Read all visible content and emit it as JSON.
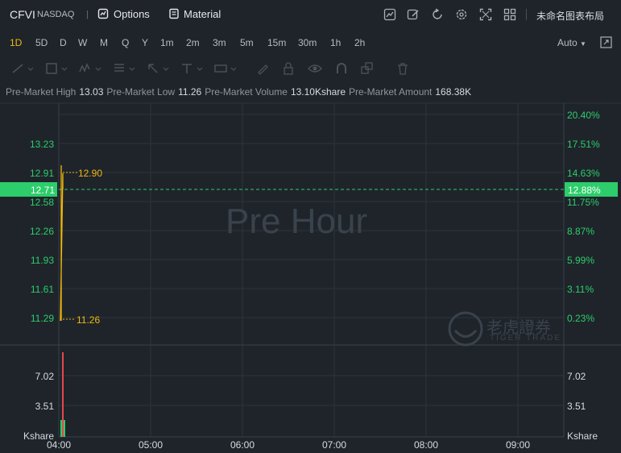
{
  "header": {
    "symbol": "CFVI",
    "exchange": "NASDAQ",
    "separator": "|",
    "options_label": "Options",
    "material_label": "Material",
    "layout_name": "未命名图表布局"
  },
  "periods": [
    "1D",
    "5D",
    "D",
    "W",
    "M",
    "Q",
    "Y",
    "1m",
    "2m",
    "3m",
    "5m",
    "15m",
    "30m",
    "1h",
    "2h"
  ],
  "active_period": "1D",
  "scale_mode": "Auto",
  "premarket": {
    "high_label": "Pre-Market High",
    "high": "13.03",
    "low_label": "Pre-Market Low",
    "low": "11.26",
    "volume_label": "Pre-Market Volume",
    "volume": "13.10Kshare",
    "amount_label": "Pre-Market Amount",
    "amount": "168.38K"
  },
  "price_axis": {
    "left_ticks": [
      "13.23",
      "12.91",
      "12.58",
      "12.26",
      "11.93",
      "11.61",
      "11.29"
    ],
    "right_ticks": [
      "20.40%",
      "17.51%",
      "14.63%",
      "11.75%",
      "8.87%",
      "5.99%",
      "3.11%",
      "0.23%"
    ],
    "current_price": "12.71",
    "current_pct": "12.88%",
    "high_marker": "12.90",
    "low_marker": "11.26"
  },
  "volume_axis": {
    "ticks": [
      "7.02",
      "3.51"
    ],
    "unit": "Kshare"
  },
  "time_axis": [
    "04:00",
    "05:00",
    "06:00",
    "07:00",
    "08:00",
    "09:00"
  ],
  "watermark": "Pre Hour",
  "brand": {
    "name": "老虎證券",
    "sub": "TIGER TRADE"
  },
  "colors": {
    "up": "#2ccd6a",
    "down": "#e5484d",
    "accent": "#f0b90b",
    "grid": "#2c333b",
    "bg": "#1f242b"
  }
}
